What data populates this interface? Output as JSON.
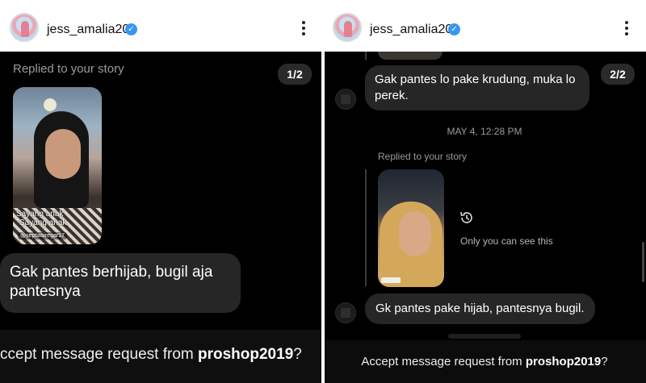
{
  "left": {
    "header": {
      "username": "jess_amalia20",
      "verified": true
    },
    "counter": "1/2",
    "replied_label": "Replied to your story",
    "story_overlay": {
      "line1": "Sayang anak",
      "line2": "Sayang anak",
      "tag": "@septiasiregar17"
    },
    "message": "Gak pantes berhijab, bugil aja pantesnya",
    "footer": {
      "prefix": "ccept message request from ",
      "account": "proshop2019",
      "suffix": "?"
    }
  },
  "right": {
    "header": {
      "username": "jess_amalia20",
      "verified": true
    },
    "counter": "2/2",
    "message1": "Gak pantes lo pake krudung, muka lo perek.",
    "timestamp": "MAY 4, 12:28 PM",
    "replied_label": "Replied to your story",
    "visibility_note": "Only you can see this",
    "message2": "Gk pantes pake hijab, pantesnya bugil.",
    "footer": {
      "prefix": "Accept message request from ",
      "account": "proshop2019",
      "suffix": "?"
    }
  },
  "colors": {
    "bubble": "#262626",
    "verified": "#3897f0",
    "background": "#000000"
  }
}
